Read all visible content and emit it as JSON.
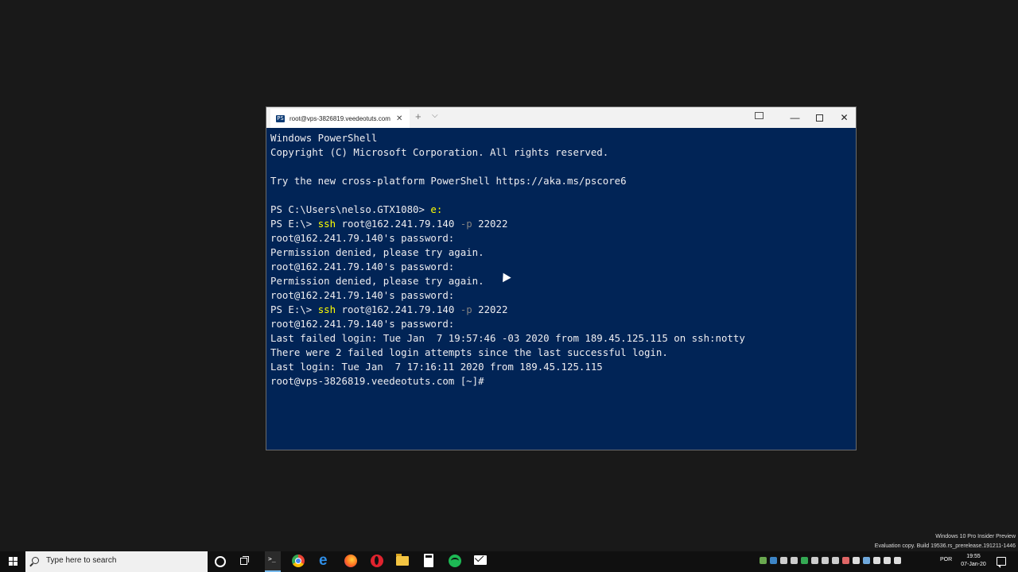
{
  "window": {
    "tab_title": "root@vps-3826819.veedeotuts.com",
    "tab_icon_glyph": "PS",
    "new_tab_glyph": "+",
    "dropdown_glyph": "⌵",
    "minimize_glyph": "—",
    "close_glyph": "✕"
  },
  "terminal": {
    "lines": [
      [
        {
          "t": "Windows PowerShell"
        }
      ],
      [
        {
          "t": "Copyright (C) Microsoft Corporation. All rights reserved."
        }
      ],
      [
        {
          "t": ""
        }
      ],
      [
        {
          "t": "Try the new cross-platform PowerShell https://aka.ms/pscore6"
        }
      ],
      [
        {
          "t": ""
        }
      ],
      [
        {
          "t": "PS C:\\Users\\nelso.GTX1080> "
        },
        {
          "t": "e:",
          "c": "cmd"
        }
      ],
      [
        {
          "t": "PS E:\\> "
        },
        {
          "t": "ssh",
          "c": "cmd"
        },
        {
          "t": " root@162.241.79.140 "
        },
        {
          "t": "-p",
          "c": "param"
        },
        {
          "t": " 22022"
        }
      ],
      [
        {
          "t": "root@162.241.79.140's password:"
        }
      ],
      [
        {
          "t": "Permission denied, please try again."
        }
      ],
      [
        {
          "t": "root@162.241.79.140's password:"
        }
      ],
      [
        {
          "t": "Permission denied, please try again."
        }
      ],
      [
        {
          "t": "root@162.241.79.140's password:"
        }
      ],
      [
        {
          "t": "PS E:\\> "
        },
        {
          "t": "ssh",
          "c": "cmd"
        },
        {
          "t": " root@162.241.79.140 "
        },
        {
          "t": "-p",
          "c": "param"
        },
        {
          "t": " 22022"
        }
      ],
      [
        {
          "t": "root@162.241.79.140's password:"
        }
      ],
      [
        {
          "t": "Last failed login: Tue Jan  7 19:57:46 -03 2020 from 189.45.125.115 on ssh:notty"
        }
      ],
      [
        {
          "t": "There were 2 failed login attempts since the last successful login."
        }
      ],
      [
        {
          "t": "Last login: Tue Jan  7 17:16:11 2020 from 189.45.125.115"
        }
      ],
      [
        {
          "t": "root@vps-3826819.veedeotuts.com [~]#"
        }
      ]
    ]
  },
  "watermark": {
    "line1": "Windows 10 Pro Insider Preview",
    "line2": "Evaluation copy. Build 19536.rs_prerelease.191211-1446"
  },
  "taskbar": {
    "search_placeholder": "Type here to search",
    "language": "POR",
    "time": "19:55",
    "date": "07-Jan-20",
    "edge_glyph": "e",
    "tray_colors": [
      "#6aa84f",
      "#3d85c6",
      "#cccccc",
      "#cccccc",
      "#34a853",
      "#cccccc",
      "#cccccc",
      "#cccccc",
      "#e06666",
      "#dddddd",
      "#6fa8dc",
      "#dddddd",
      "#dddddd",
      "#dddddd"
    ]
  }
}
